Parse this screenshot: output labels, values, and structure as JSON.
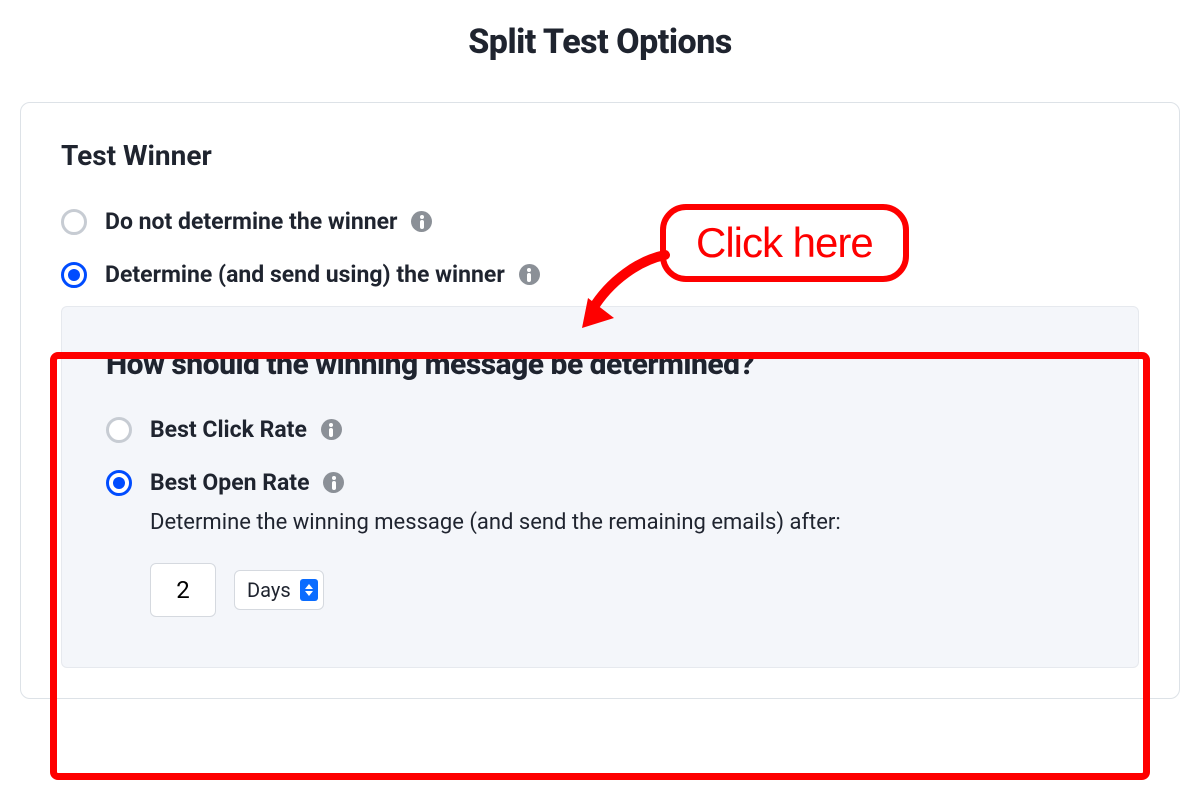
{
  "title": "Split Test Options",
  "testWinner": {
    "section_label": "Test Winner",
    "options": [
      {
        "label": "Do not determine the winner",
        "selected": false
      },
      {
        "label": "Determine (and send using) the winner",
        "selected": true
      }
    ]
  },
  "determination": {
    "heading": "How should the winning message be determined?",
    "options": [
      {
        "label": "Best Click Rate",
        "selected": false
      },
      {
        "label": "Best Open Rate",
        "selected": true
      }
    ],
    "after_text": "Determine the winning message (and send the remaining emails) after:",
    "value": "2",
    "unit": "Days"
  },
  "annotation": {
    "label": "Click here"
  }
}
